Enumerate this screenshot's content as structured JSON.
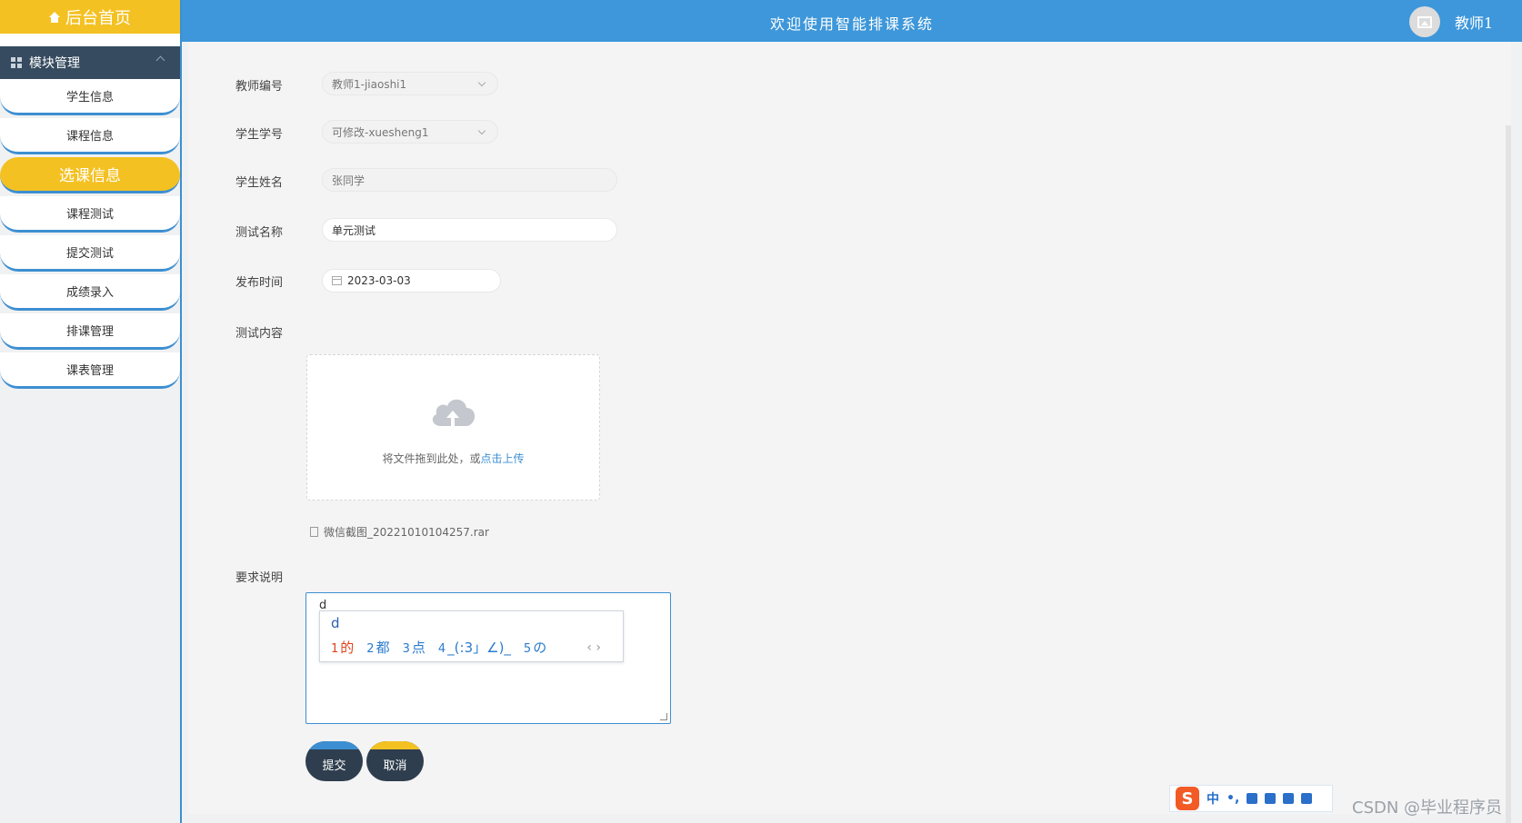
{
  "sidebar": {
    "home_label": "后台首页",
    "module_label": "模块管理",
    "items": [
      {
        "label": "学生信息"
      },
      {
        "label": "课程信息"
      },
      {
        "label": "选课信息"
      },
      {
        "label": "课程测试"
      },
      {
        "label": "提交测试"
      },
      {
        "label": "成绩录入"
      },
      {
        "label": "排课管理"
      },
      {
        "label": "课表管理"
      }
    ],
    "active_index": 2
  },
  "header": {
    "title": "欢迎使用智能排课系统",
    "user": "教师1"
  },
  "form": {
    "teacher_id": {
      "label": "教师编号",
      "value": "教师1-jiaoshi1"
    },
    "student_id": {
      "label": "学生学号",
      "value": "可修改-xuesheng1"
    },
    "student_name": {
      "label": "学生姓名",
      "value": "张同学"
    },
    "test_name": {
      "label": "测试名称",
      "value": "单元测试"
    },
    "publish_time": {
      "label": "发布时间",
      "value": "2023-03-03"
    },
    "test_content": {
      "label": "测试内容",
      "upload_hint": "将文件拖到此处，或",
      "upload_link": "点击上传",
      "file_name": "微信截图_20221010104257.rar"
    },
    "requirements": {
      "label": "要求说明",
      "value": "d"
    },
    "submit_label": "提交",
    "cancel_label": "取消"
  },
  "ime": {
    "composing": "d",
    "candidates": [
      {
        "num": "1",
        "text": "的"
      },
      {
        "num": "2",
        "text": "都"
      },
      {
        "num": "3",
        "text": "点"
      },
      {
        "num": "4",
        "text": "_(:3」∠)_"
      },
      {
        "num": "5",
        "text": "の"
      }
    ],
    "next": "‹ ›",
    "toolbar_mode": "中",
    "toolbar_punct": "•,"
  },
  "watermark": "CSDN @毕业程序员",
  "colors": {
    "accent_blue": "#3d97da",
    "accent_yellow": "#f4c122",
    "dark_panel": "#364b5f"
  }
}
